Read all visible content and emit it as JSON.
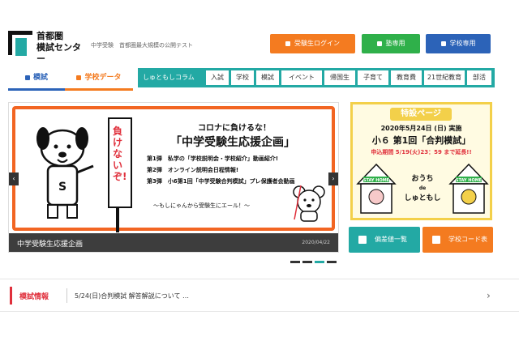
{
  "header": {
    "logo": [
      "首都圏",
      "模試センター"
    ],
    "tagline": "中学受験　首都圏最大規模の公開テスト",
    "buttons": {
      "student_login": "受験生ログイン",
      "juku": "塾専用",
      "school": "学校専用"
    }
  },
  "nav": {
    "tabs": [
      {
        "label": "模試"
      },
      {
        "label": "学校データ"
      }
    ],
    "column": "しゅともしコラム",
    "categories": [
      "入試",
      "学校",
      "模試",
      "イベント",
      "帰国生",
      "子育て",
      "教育費",
      "21世紀教育",
      "部活"
    ]
  },
  "hero": {
    "sign_text": "負けないぞ!",
    "head1": "コロナに負けるな！",
    "head2": "「中学受験生応援企画」",
    "lines": [
      "第1弾　私学の「学校説明会・学校紹介」動画紹介!",
      "第2弾　オンライン説明会日程情報!",
      "第3弾　小6第1回「中学受験合判模試」プレ保護者会動画"
    ],
    "foot": "〜もしにゃんから受験生にエール！〜",
    "caption": "中学受験生応援企画",
    "date": "2020/04/22",
    "slide_count": 4,
    "active_slide": 3
  },
  "special": {
    "label": "特設ページ",
    "date": "2020年5月24日 (日) 実施",
    "main": "小６ 第1回「合判模試」",
    "note": "申込期間 5/19(火)23：59 まで延長!!",
    "house_sign": "STAY HOME",
    "ouchi": [
      "おうち",
      "de",
      "しゅともし"
    ]
  },
  "side_buttons": {
    "hensachi": "偏差値一覧",
    "school_code": "学校コード表"
  },
  "news": {
    "title": "模試情報",
    "text": "5/24(日)合判模試 解答解説について …"
  },
  "colors": {
    "orange": "#f47b20",
    "green": "#2fb04a",
    "blue": "#2c63b8",
    "teal": "#23a9a4",
    "red": "#e0303c",
    "yellow": "#f3d04a"
  }
}
